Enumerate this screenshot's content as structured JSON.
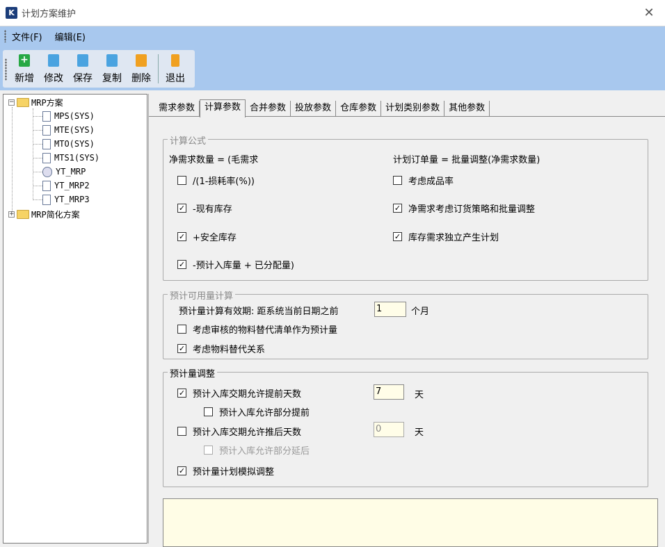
{
  "window": {
    "title": "计划方案维护",
    "close_glyph": "✕"
  },
  "menu": {
    "file": "文件(F)",
    "edit": "编辑(E)"
  },
  "toolbar": {
    "add": "新增",
    "edit": "修改",
    "save": "保存",
    "copy": "复制",
    "delete": "删除",
    "exit": "退出"
  },
  "tree": {
    "root1": "MRP方案",
    "children": [
      "MPS(SYS)",
      "MTE(SYS)",
      "MTO(SYS)",
      "MTS1(SYS)",
      "YT_MRP",
      "YT_MRP2",
      "YT_MRP3"
    ],
    "root2": "MRP简化方案",
    "collapse_glyph": "−",
    "expand_glyph": "+"
  },
  "tabs": [
    "需求参数",
    "计算参数",
    "合并参数",
    "投放参数",
    "仓库参数",
    "计划类别参数",
    "其他参数"
  ],
  "active_tab": "计算参数",
  "calc_formula": {
    "title": "计算公式",
    "net_req_label": "净需求数量 = (毛需求",
    "order_label": "计划订单量 =   批量调整(净需求数量)",
    "loss_rate": {
      "label": "/(1-损耗率(%))",
      "checked": false
    },
    "yield_rate": {
      "label": "考虑成品率",
      "checked": false
    },
    "on_hand": {
      "label": "-现有库存",
      "checked": true
    },
    "order_policy": {
      "label": "净需求考虑订货策略和批量调整",
      "checked": true
    },
    "safety_stock": {
      "label": "+安全库存",
      "checked": true
    },
    "stock_independent": {
      "label": "库存需求独立产生计划",
      "checked": true
    },
    "expected_in": {
      "label": "-预计入库量 + 已分配量)",
      "checked": true
    }
  },
  "available_calc": {
    "title": "预计可用量计算",
    "valid_period_label": "预计量计算有效期:  距系统当前日期之前",
    "valid_period_value": "1",
    "valid_period_unit": "个月",
    "audited_bom": {
      "label": "考虑审核的物料替代清单作为预计量",
      "checked": false
    },
    "substitution": {
      "label": "考虑物料替代关系",
      "checked": true
    }
  },
  "adjustment": {
    "title": "预计量调整",
    "advance_days": {
      "label": "预计入库交期允许提前天数",
      "checked": true,
      "value": "7",
      "unit": "天"
    },
    "advance_partial": {
      "label": "预计入库允许部分提前",
      "checked": false
    },
    "delay_days": {
      "label": "预计入库交期允许推后天数",
      "checked": false,
      "value": "0",
      "unit": "天"
    },
    "delay_partial": {
      "label": "预计入库允许部分延后",
      "checked": false
    },
    "simulate": {
      "label": "预计量计划模拟调整",
      "checked": true
    }
  },
  "check_glyph": "✓",
  "colors": {
    "menu_bg": "#a8c8ee",
    "input_bg": "#fffde8",
    "memo_bg": "#fffde6"
  }
}
